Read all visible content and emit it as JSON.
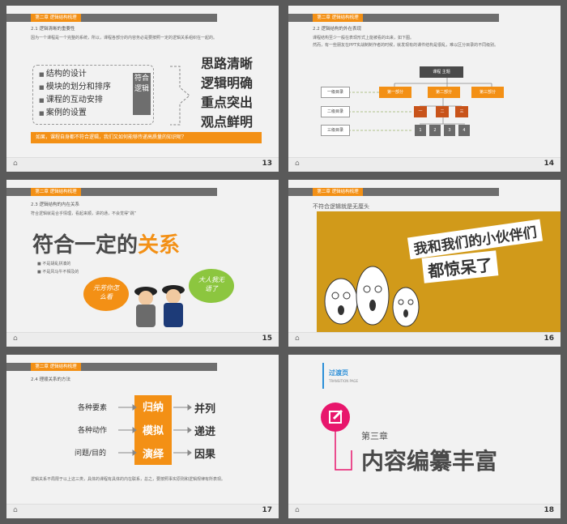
{
  "chapter_tag": "第二章 逻辑结构梳理",
  "footer_home": "⌂",
  "s13": {
    "subhead": "2.1 逻辑清晰的重要性",
    "desc": "因为一个课程是一个完整的系统，所以，课程各部分的内容务必是要按照一定的逻辑关系组织在一起的。",
    "bullets": [
      "结构的设计",
      "模块的划分和排序",
      "课程的互动安排",
      "案例的设置"
    ],
    "vbox": "符合逻辑",
    "words": [
      "思路清晰",
      "逻辑明确",
      "重点突出",
      "观点鲜明"
    ],
    "bottom": "如果，课程自身都不符合逻辑，我们又如何能够传递高质量的知识呢？",
    "num": "13"
  },
  "s14": {
    "subhead": "2.2 逻辑结构的外在表现",
    "desc1": "课程结构至少一般在表现形式上能被看的出来，如下图。",
    "desc2": "然而，有一些朋友在PPT实战制制作者的时候，就发现有的课件结构是很乱，难以区分目录的不同级别。",
    "root": "课程 主题",
    "level_labels": [
      "一级目录",
      "二级目录",
      "三级目录"
    ],
    "l1": [
      "第一部分",
      "第二部分",
      "第三部分"
    ],
    "l2": [
      "一",
      "二",
      "三"
    ],
    "l3": [
      "1",
      "2",
      "3",
      "4"
    ],
    "num": "14"
  },
  "s15": {
    "subhead": "2.3 逻辑结构的内在关系",
    "desc": "符合逻辑就是合乎情理，看起来顺，讲的通，不会觉得“跳”",
    "title_a": "符合一定的",
    "title_b": "关系",
    "bullets": [
      "不是胡乱拼凑的",
      "不是风马牛不相及的"
    ],
    "bubble_orange": "元芳你怎么看",
    "bubble_green": "大人我无语了",
    "num": "15"
  },
  "s16": {
    "subhead": "不符合逻辑就是无厘头",
    "meme_a": "我和我们的小伙伴们",
    "meme_b": "都惊呆了",
    "num": "16"
  },
  "s17": {
    "subhead": "2.4 理顺关系的方法",
    "left": [
      "各种要素",
      "各种动作",
      "问题/目的"
    ],
    "mid": [
      "归纳",
      "模拟",
      "演绎"
    ],
    "right": [
      "并列",
      "递进",
      "因果"
    ],
    "bottom": "逻辑关系不局限于以上这三类，具体的课程有具体的内在联系，总之，要按照事实原则和逻辑规律有所表现。",
    "num": "17"
  },
  "s18": {
    "label": "过渡页",
    "label_en": "TRANSITION PAGE",
    "chapter": "第三章",
    "title": "内容编纂丰富",
    "num": "18"
  }
}
